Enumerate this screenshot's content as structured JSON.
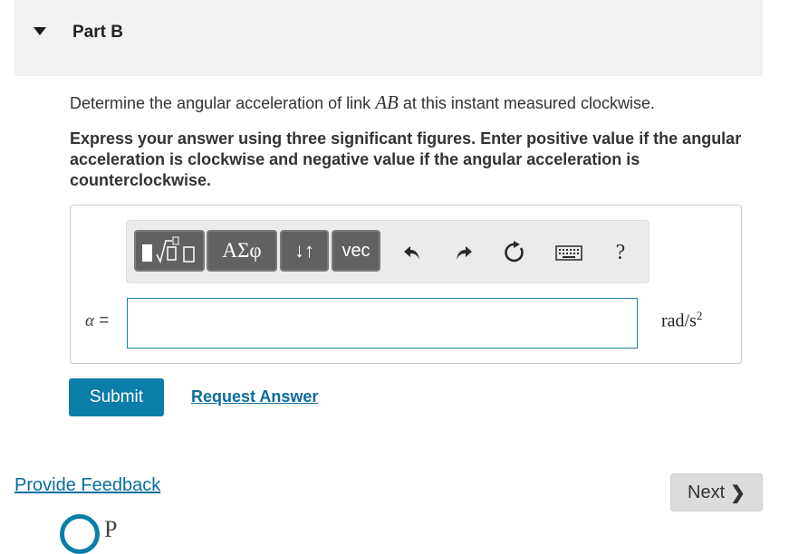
{
  "part": {
    "title": "Part B"
  },
  "question": {
    "prefix": "Determine the angular acceleration of link ",
    "var": "AB",
    "suffix": " at this instant measured clockwise."
  },
  "instructions": "Express your answer using three significant figures. Enter positive value if the angular acceleration is clockwise and negative value if the angular acceleration is counterclockwise.",
  "toolbar": {
    "greek_label": "ΑΣφ",
    "arrows_label": "↓↑",
    "vec_label": "vec",
    "help_label": "?"
  },
  "answer": {
    "label_symbol": "α",
    "label_eq": " =",
    "value": "",
    "unit_base": "rad/s",
    "unit_exp": "2"
  },
  "actions": {
    "submit": "Submit",
    "request": "Request Answer"
  },
  "footer": {
    "feedback": "Provide Feedback",
    "next": "Next",
    "logo_letter": "P"
  }
}
